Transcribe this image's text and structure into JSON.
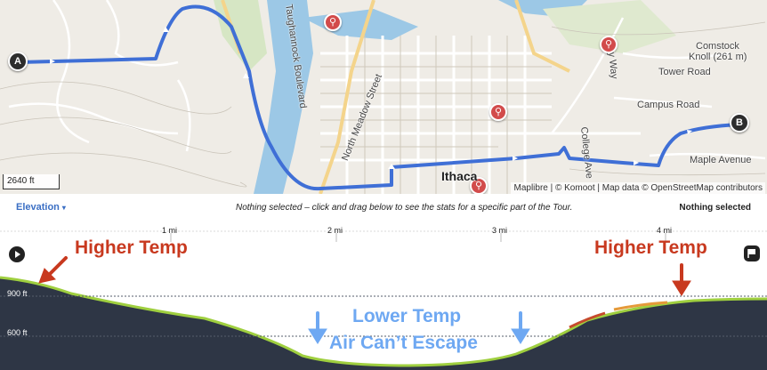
{
  "map": {
    "scale_label": "2640 ft",
    "attribution": "Maplibre | © Komoot | Map data © OpenStreetMap contributors",
    "start_marker": "A",
    "end_marker": "B",
    "labels": {
      "city": "Ithaca",
      "north_meadow": "North Meadow Street",
      "taughannock": "Taughannock Boulevard",
      "cornell_way": "y Way",
      "college_ave": "College Ave",
      "tower_road": "Tower Road",
      "campus_road": "Campus Road",
      "maple_ave": "Maple Avenue",
      "comstock_1": "Comstock",
      "comstock_2": "Knoll (261 m)"
    },
    "colors": {
      "route": "#3f6fd6",
      "bike_pin": "#d24b4b"
    }
  },
  "toolbar": {
    "elevation_tab": "Elevation",
    "hint": "Nothing selected – click and drag below to see the stats for a specific part of the Tour.",
    "selected_status": "Nothing selected"
  },
  "profile": {
    "distance_ticks": [
      "1 mi",
      "2 mi",
      "3 mi",
      "4 mi"
    ],
    "altitude_ticks": [
      "900 ft",
      "600 ft"
    ]
  },
  "annotations": {
    "higher_temp_left": "Higher Temp",
    "higher_temp_right": "Higher Temp",
    "lower_temp": "Lower Temp",
    "air_cant_escape": "Air Can’t Escape"
  }
}
